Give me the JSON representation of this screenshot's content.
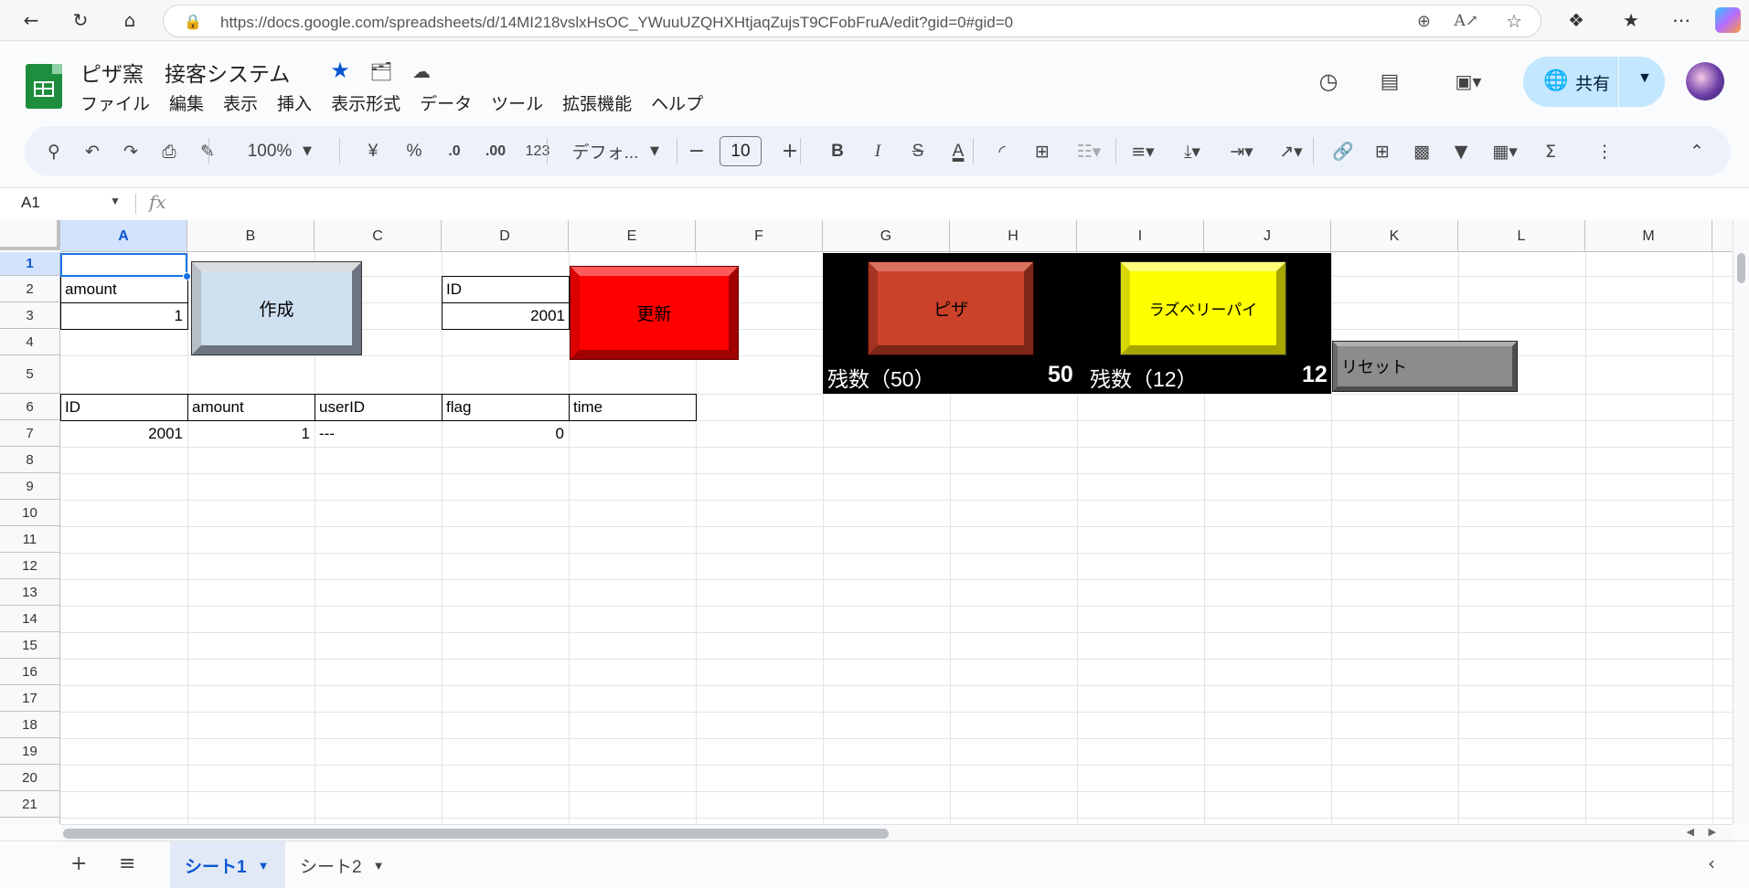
{
  "browser": {
    "url": "https://docs.google.com/spreadsheets/d/14MI218vslxHsOC_YWuuUZQHXHtjaqZujsT9CFobFruA/edit?gid=0#gid=0"
  },
  "doc": {
    "title": "ピザ窯　接客システム",
    "menu": [
      "ファイル",
      "編集",
      "表示",
      "挿入",
      "表示形式",
      "データ",
      "ツール",
      "拡張機能",
      "ヘルプ"
    ],
    "share_label": "共有"
  },
  "toolbar": {
    "zoom": "100%",
    "currency": "¥",
    "percent": "%",
    "dec_decrease": ".0",
    "dec_increase": ".00",
    "number_format": "123",
    "font_name": "デフォ...",
    "font_size": "10",
    "bold": "B",
    "italic": "I",
    "strike": "S",
    "text_color": "A"
  },
  "formula_bar": {
    "name_box": "A1",
    "fx": "fx"
  },
  "grid": {
    "columns": [
      "A",
      "B",
      "C",
      "D",
      "E",
      "F",
      "G",
      "H",
      "I",
      "J",
      "K",
      "L",
      "M"
    ],
    "rows": [
      "1",
      "2",
      "3",
      "4",
      "5",
      "6",
      "7",
      "8",
      "9",
      "10",
      "11",
      "12",
      "13",
      "14",
      "15",
      "16",
      "17",
      "18",
      "19",
      "20",
      "21"
    ],
    "cells": {
      "a2": "amount",
      "a3": "1",
      "d2": "ID",
      "d3": "2001",
      "table_headers": [
        "ID",
        "amount",
        "userID",
        "flag",
        "time"
      ],
      "table_row": [
        "2001",
        "1",
        "---",
        "0",
        ""
      ]
    }
  },
  "buttons": {
    "create": "作成",
    "update": "更新",
    "pizza": "ピザ",
    "raspberry": "ラズベリーパイ",
    "reset": "リセット"
  },
  "stock": {
    "pizza_label": "残数（50）",
    "pizza_value": "50",
    "rasp_label": "残数（12）",
    "rasp_value": "12"
  },
  "sheets": {
    "tabs": [
      "シート1",
      "シート2"
    ],
    "active": "シート1"
  },
  "colors": {
    "accent": "#0b57d0",
    "update_button": "#ff0000",
    "pizza_button": "#cc4129",
    "rasp_button": "#ffff00",
    "create_button": "#cfe0f1",
    "reset_button": "#8c8c8c"
  }
}
